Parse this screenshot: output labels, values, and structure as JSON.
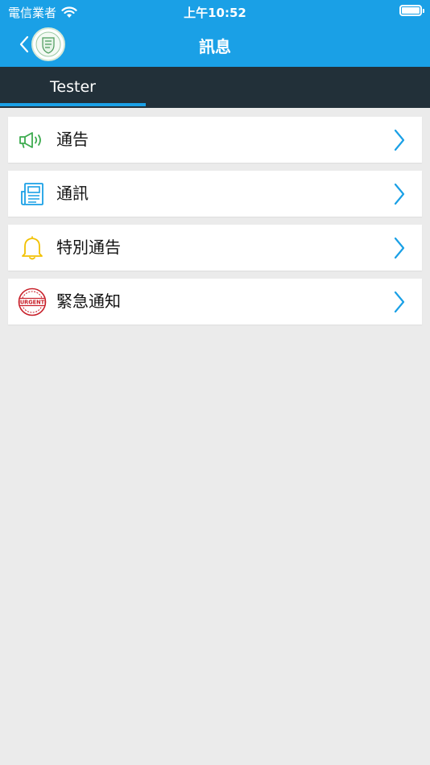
{
  "status_bar": {
    "carrier": "電信業者",
    "time": "上午10:52"
  },
  "navbar": {
    "title": "訊息"
  },
  "tabs": [
    {
      "label": "Tester",
      "active": true
    }
  ],
  "menu": [
    {
      "label": "通告",
      "icon": "megaphone-icon",
      "color": "#3dab4f"
    },
    {
      "label": "通訊",
      "icon": "newsletter-icon",
      "color": "#1aa0e6"
    },
    {
      "label": "特別通告",
      "icon": "bell-icon",
      "color": "#f2c100"
    },
    {
      "label": "緊急通知",
      "icon": "urgent-stamp-icon",
      "color": "#c8202a",
      "stamp_text": "URGENT"
    }
  ],
  "colors": {
    "accent": "#1aa0e6",
    "tabbar": "#223039",
    "background": "#ebebeb"
  }
}
